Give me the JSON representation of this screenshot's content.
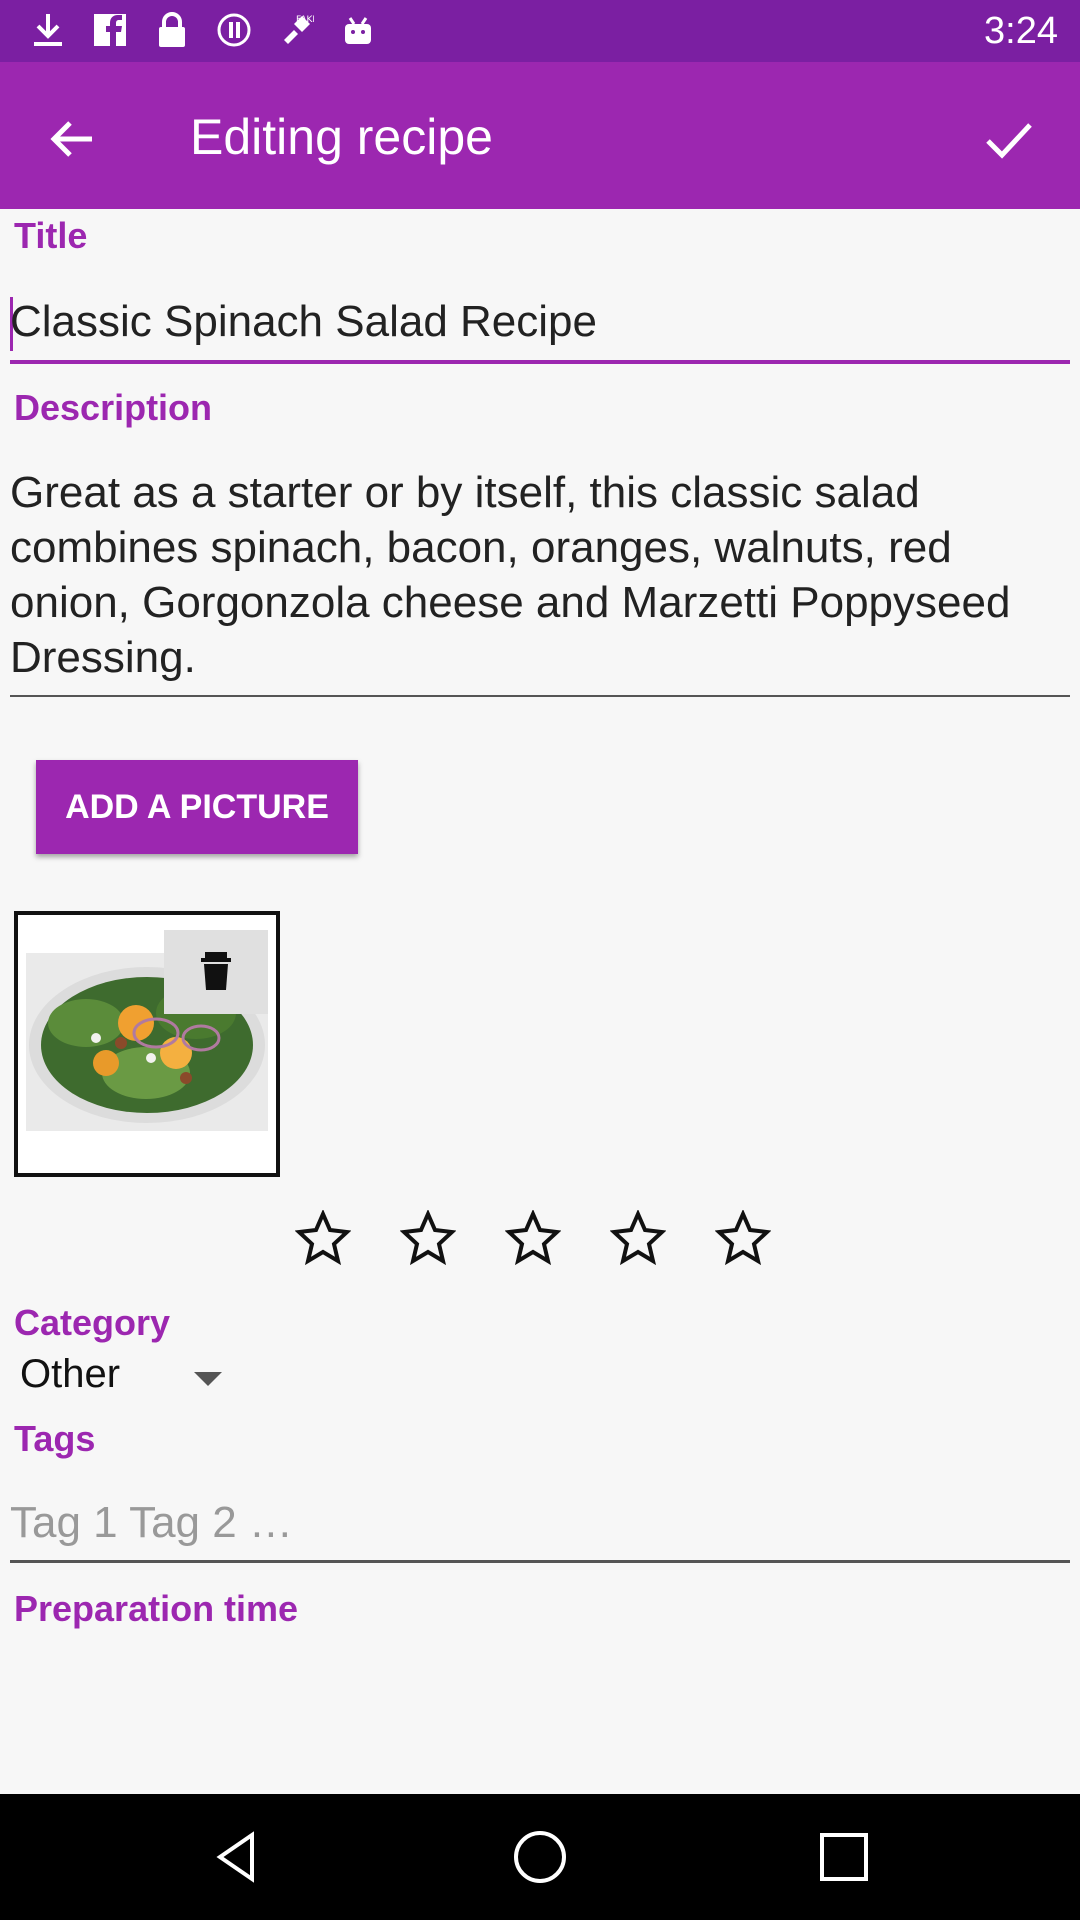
{
  "status_bar": {
    "time": "3:24",
    "icons": [
      "download-icon",
      "facebook-icon",
      "lock-icon",
      "data-saver-icon",
      "fake-gps-icon",
      "android-icon"
    ]
  },
  "app_bar": {
    "title": "Editing recipe",
    "back_icon": "arrow-back-icon",
    "confirm_icon": "check-icon"
  },
  "form": {
    "title_label": "Title",
    "title_value": "Classic Spinach Salad Recipe",
    "description_label": "Description",
    "description_value": "Great as a starter or by itself, this classic salad combines spinach, bacon, oranges, walnuts, red onion, Gorgonzola cheese and Marzetti Poppyseed Dressing.",
    "add_picture_button": "ADD A PICTURE",
    "rating": {
      "value": 0,
      "max": 5
    },
    "category_label": "Category",
    "category_value": "Other",
    "tags_label": "Tags",
    "tags_placeholder": "Tag 1 Tag 2 …",
    "preparation_label": "Preparation time"
  },
  "colors": {
    "status_bar": "#7b1fa2",
    "app_bar": "#9c27b0",
    "accent": "#9c27b0",
    "background": "#f7f7f7"
  },
  "nav_bar": {
    "icons": [
      "back-triangle-icon",
      "home-circle-icon",
      "recents-square-icon"
    ]
  }
}
